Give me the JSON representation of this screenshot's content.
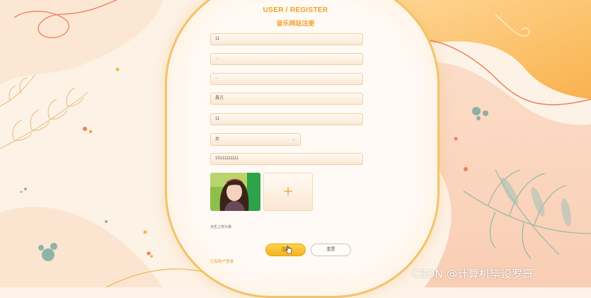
{
  "header": {
    "title_en": "USER / REGISTER",
    "title_cn": "音乐网站注册"
  },
  "form": {
    "fields": [
      {
        "name": "username",
        "value": "11"
      },
      {
        "name": "password",
        "value": "··"
      },
      {
        "name": "confirm_password",
        "value": "··"
      },
      {
        "name": "nickname",
        "value": "晨方"
      },
      {
        "name": "age",
        "value": "11"
      }
    ],
    "gender": {
      "selected": "女"
    },
    "phone": "15111111111",
    "upload_hint": "点击上传头像",
    "register_label": "注册",
    "reset_label": "重置",
    "login_link": "已有账户登录"
  },
  "watermark": "CSDN @计算机毕设罗哥",
  "colors": {
    "accent": "#f0a02a",
    "button_gold": "#ffd24d",
    "background": "#fdf3e8"
  }
}
